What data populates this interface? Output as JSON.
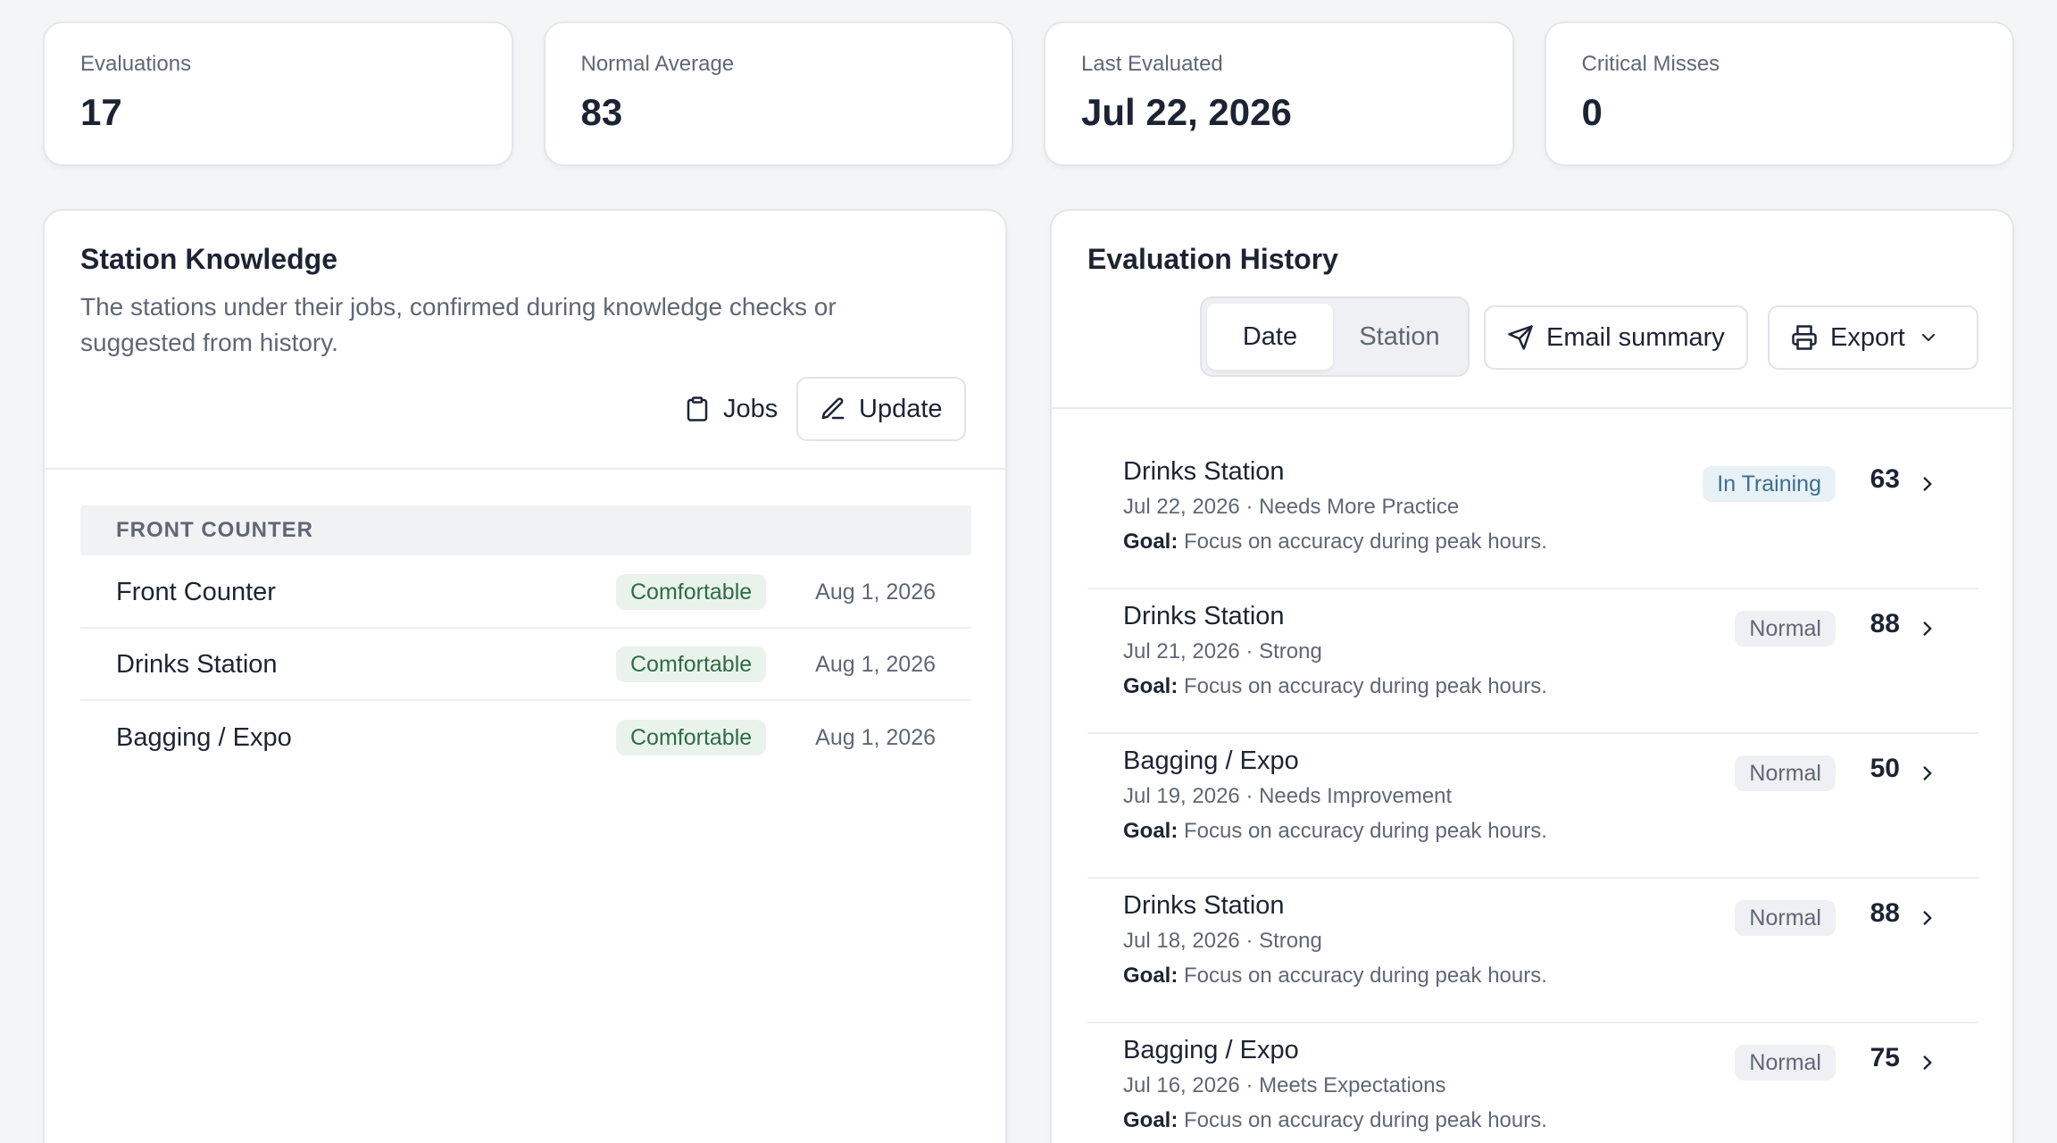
{
  "stats": [
    {
      "label": "Evaluations",
      "value": "17"
    },
    {
      "label": "Normal Average",
      "value": "83"
    },
    {
      "label": "Last Evaluated",
      "value": "Jul 22, 2026"
    },
    {
      "label": "Critical Misses",
      "value": "0"
    }
  ],
  "knowledge": {
    "title": "Station Knowledge",
    "description": "The stations under their jobs, confirmed during knowledge checks or suggested from history.",
    "jobs_label": "Jobs",
    "update_label": "Update",
    "group": "FRONT COUNTER",
    "rows": [
      {
        "name": "Front Counter",
        "status": "Comfortable",
        "date": "Aug 1, 2026"
      },
      {
        "name": "Drinks Station",
        "status": "Comfortable",
        "date": "Aug 1, 2026"
      },
      {
        "name": "Bagging / Expo",
        "status": "Comfortable",
        "date": "Aug 1, 2026"
      }
    ]
  },
  "history": {
    "title": "Evaluation History",
    "toggle": {
      "date": "Date",
      "station": "Station",
      "selected": "Date"
    },
    "email_label": "Email summary",
    "export_label": "Export",
    "goal_prefix": "Goal:",
    "rows": [
      {
        "station": "Drinks Station",
        "sub": "Jul 22, 2026 · Needs More Practice",
        "goal": "Focus on accuracy during peak hours.",
        "badge": "In Training",
        "score": "63"
      },
      {
        "station": "Drinks Station",
        "sub": "Jul 21, 2026 · Strong",
        "goal": "Focus on accuracy during peak hours.",
        "badge": "Normal",
        "score": "88"
      },
      {
        "station": "Bagging / Expo",
        "sub": "Jul 19, 2026 · Needs Improvement",
        "goal": "Focus on accuracy during peak hours.",
        "badge": "Normal",
        "score": "50"
      },
      {
        "station": "Drinks Station",
        "sub": "Jul 18, 2026 · Strong",
        "goal": "Focus on accuracy during peak hours.",
        "badge": "Normal",
        "score": "88"
      },
      {
        "station": "Bagging / Expo",
        "sub": "Jul 16, 2026 · Meets Expectations",
        "goal": "Focus on accuracy during peak hours.",
        "badge": "Normal",
        "score": "75"
      }
    ]
  }
}
